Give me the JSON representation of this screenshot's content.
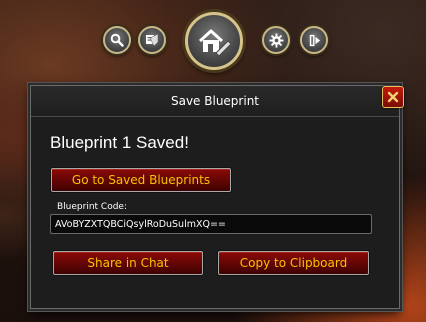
{
  "toolbar": {
    "buttons": [
      {
        "name": "search-icon"
      },
      {
        "name": "blueprints-icon"
      },
      {
        "name": "housing-edit-icon"
      },
      {
        "name": "gear-icon"
      },
      {
        "name": "exit-icon"
      }
    ]
  },
  "dialog": {
    "title": "Save Blueprint",
    "heading": "Blueprint 1 Saved!",
    "go_to_saved_label": "Go to Saved Blueprints",
    "code_label": "Blueprint Code:",
    "code_value": "AVoBYZXTQBCiQsylRoDuSulmXQ==",
    "share_label": "Share in Chat",
    "copy_label": "Copy to Clipboard"
  },
  "colors": {
    "button_text": "#f5c400",
    "button_fill": "#6a0704",
    "close_fill": "#c21a0a"
  }
}
